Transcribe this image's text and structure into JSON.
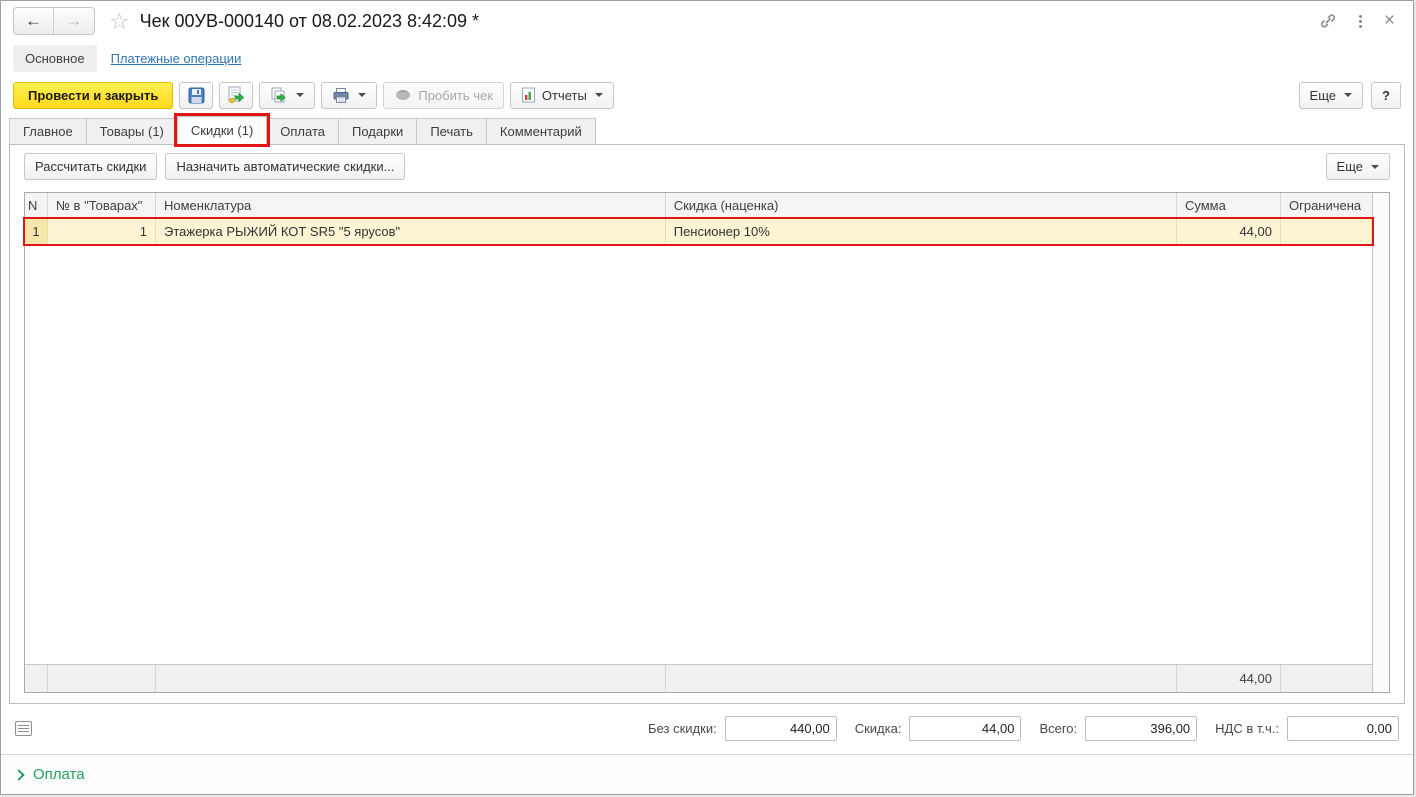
{
  "titlebar": {
    "title": "Чек 00УВ-000140 от 08.02.2023 8:42:09 *",
    "back_glyph": "←",
    "forward_glyph": "→",
    "star_glyph": "☆",
    "close_glyph": "×"
  },
  "nav": {
    "main_label": "Основное",
    "payments_label": "Платежные операции"
  },
  "toolbar": {
    "post_close_label": "Провести и закрыть",
    "fiscal_label": "Пробить чек",
    "reports_label": "Отчеты",
    "more_label": "Еще",
    "help_label": "?"
  },
  "tabs": [
    "Главное",
    "Товары (1)",
    "Скидки (1)",
    "Оплата",
    "Подарки",
    "Печать",
    "Комментарий"
  ],
  "commands": {
    "calculate_label": "Рассчитать скидки",
    "assign_auto_label": "Назначить автоматические скидки...",
    "more_label": "Еще"
  },
  "table": {
    "columns": [
      "N",
      "№ в \"Товарах\"",
      "Номенклатура",
      "Скидка (наценка)",
      "Сумма",
      "Ограничена"
    ],
    "rows": [
      {
        "n": "1",
        "num_in_goods": "1",
        "nomenclature": "Этажерка РЫЖИЙ КОТ SR5  \"5 ярусов\"",
        "discount": "Пенсионер 10%",
        "sum": "44,00",
        "limited": ""
      }
    ],
    "footer": {
      "sum_total": "44,00"
    }
  },
  "totals": {
    "no_discount_label": "Без скидки:",
    "no_discount_value": "440,00",
    "discount_label": "Скидка:",
    "discount_value": "44,00",
    "total_label": "Всего:",
    "total_value": "396,00",
    "vat_label": "НДС в т.ч.:",
    "vat_value": "0,00"
  },
  "payment_section": {
    "label": "Оплата"
  },
  "colors": {
    "accent_yellow": "#ffe11c",
    "annotation_red": "#e21414",
    "link_blue": "#2e74b8",
    "section_green": "#23a05e",
    "row_highlight": "#fcf4d2"
  }
}
